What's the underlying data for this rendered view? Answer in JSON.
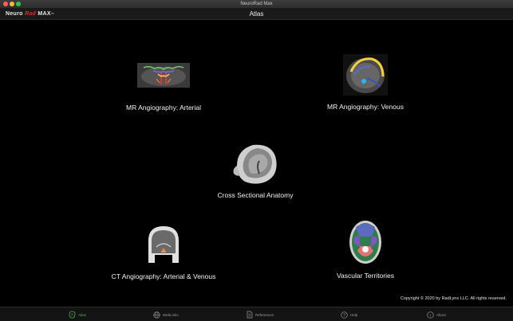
{
  "window": {
    "title": "NeuroRad Max"
  },
  "app": {
    "logo_part1": "Neuro ",
    "logo_part2": "Rad",
    "logo_part3": " MAX",
    "logo_tm": "™"
  },
  "navbar": {
    "title": "Atlas"
  },
  "tiles": [
    {
      "label": "MR Angiography: Arterial"
    },
    {
      "label": "MR Angiography: Venous"
    },
    {
      "label": "Cross Sectional Anatomy"
    },
    {
      "label": "CT Angiography:  Arterial & Venous"
    },
    {
      "label": "Vascular Territories"
    }
  ],
  "footer": {
    "copyright": "Copyright © 2020 by RadLynx LLC.  All rights reserved."
  },
  "tabs": [
    {
      "label": "Atlas",
      "icon": "atlas-icon",
      "active": true
    },
    {
      "label": "WebLinks",
      "icon": "globe-icon"
    },
    {
      "label": "References",
      "icon": "document-icon"
    },
    {
      "label": "Help",
      "icon": "question-icon"
    },
    {
      "label": "About",
      "icon": "info-icon"
    }
  ],
  "colors": {
    "accent": "#4caf50",
    "logo_red": "#d32f2f",
    "background": "#000000"
  }
}
